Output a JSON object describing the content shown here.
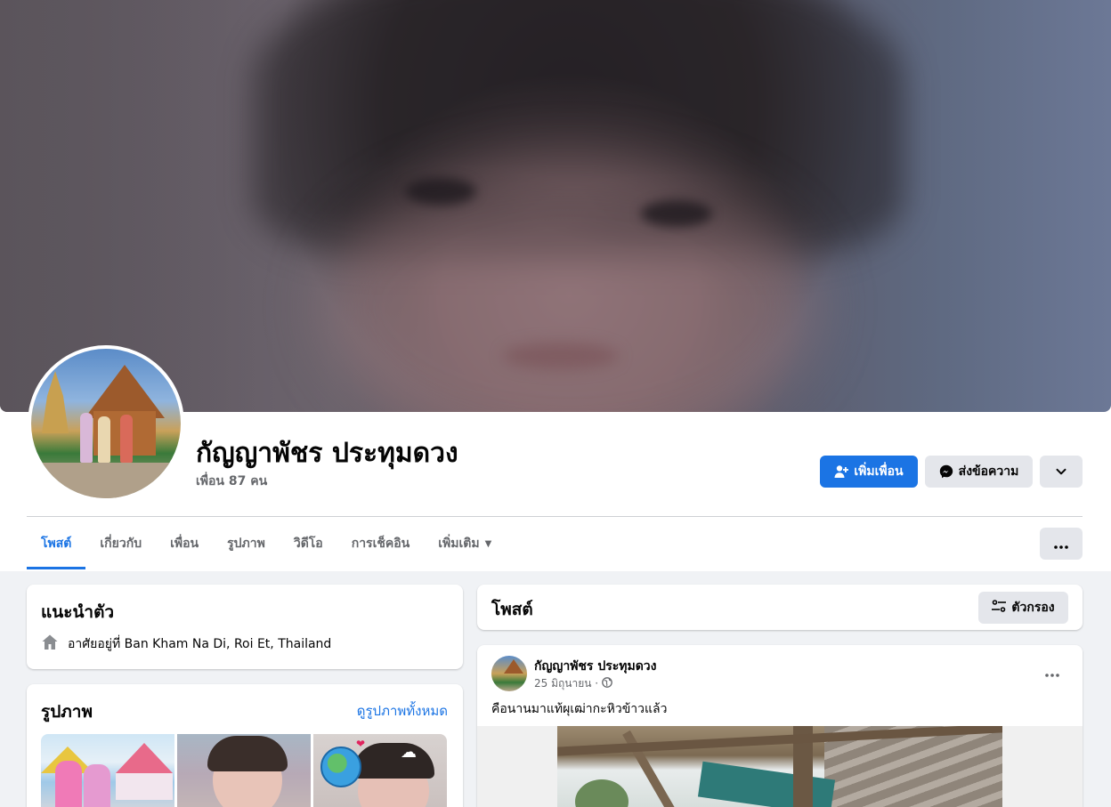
{
  "profile": {
    "name": "กัญญาพัชร ประทุมดวง",
    "friends_count": "เพื่อน 87 คน"
  },
  "actions": {
    "add_friend": "เพิ่มเพื่อน",
    "message": "ส่งข้อความ"
  },
  "tabs": [
    {
      "label": "โพสต์",
      "active": true
    },
    {
      "label": "เกี่ยวกับ",
      "active": false
    },
    {
      "label": "เพื่อน",
      "active": false
    },
    {
      "label": "รูปภาพ",
      "active": false
    },
    {
      "label": "วิดีโอ",
      "active": false
    },
    {
      "label": "การเช็คอิน",
      "active": false
    },
    {
      "label": "เพิ่มเติม",
      "active": false
    }
  ],
  "intro": {
    "title": "แนะนำตัว",
    "lives_in": "อาศัยอยู่ที่ Ban Kham Na Di, Roi Et, Thailand"
  },
  "photos": {
    "title": "รูปภาพ",
    "see_all": "ดูรูปภาพทั้งหมด"
  },
  "posts": {
    "title": "โพสต์",
    "filter_label": "ตัวกรอง"
  },
  "post": {
    "author": "กัญญาพัชร ประทุมดวง",
    "date": "25 มิถุนายน ·",
    "text": "คือนานมาแท้ผุเฒ่ากะหิวข้าวแล้ว"
  },
  "colors": {
    "accent": "#1b74e4",
    "background": "#f0f2f5",
    "secondary_button": "#e4e6eb",
    "muted_text": "#65676b"
  }
}
